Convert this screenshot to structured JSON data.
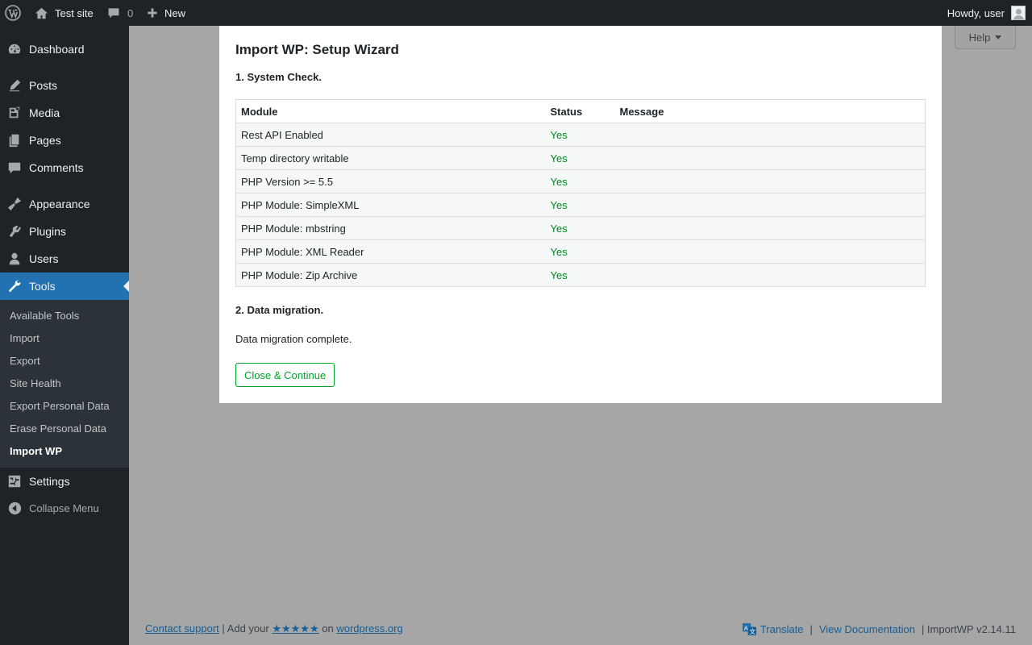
{
  "adminbar": {
    "site_name": "Test site",
    "comments_count": "0",
    "new_label": "New",
    "howdy": "Howdy, user"
  },
  "sidebar": {
    "items": [
      {
        "label": "Dashboard",
        "icon": "dashboard-icon"
      },
      {
        "label": "Posts",
        "icon": "posts-icon"
      },
      {
        "label": "Media",
        "icon": "media-icon"
      },
      {
        "label": "Pages",
        "icon": "pages-icon"
      },
      {
        "label": "Comments",
        "icon": "comments-icon"
      },
      {
        "label": "Appearance",
        "icon": "appearance-icon"
      },
      {
        "label": "Plugins",
        "icon": "plugins-icon"
      },
      {
        "label": "Users",
        "icon": "users-icon"
      },
      {
        "label": "Tools",
        "icon": "tools-icon"
      },
      {
        "label": "Settings",
        "icon": "settings-icon"
      }
    ],
    "submenu": [
      "Available Tools",
      "Import",
      "Export",
      "Site Health",
      "Export Personal Data",
      "Erase Personal Data",
      "Import WP"
    ],
    "collapse_label": "Collapse Menu"
  },
  "help": {
    "label": "Help"
  },
  "modal": {
    "title": "Import WP: Setup Wizard",
    "section1": "1. System Check.",
    "table": {
      "headers": [
        "Module",
        "Status",
        "Message"
      ],
      "rows": [
        [
          "Rest API Enabled",
          "Yes",
          ""
        ],
        [
          "Temp directory writable",
          "Yes",
          ""
        ],
        [
          "PHP Version >= 5.5",
          "Yes",
          ""
        ],
        [
          "PHP Module: SimpleXML",
          "Yes",
          ""
        ],
        [
          "PHP Module: mbstring",
          "Yes",
          ""
        ],
        [
          "PHP Module: XML Reader",
          "Yes",
          ""
        ],
        [
          "PHP Module: Zip Archive",
          "Yes",
          ""
        ]
      ]
    },
    "section2": "2. Data migration.",
    "migration_message": "Data migration complete.",
    "button": "Close & Continue"
  },
  "footer": {
    "contact": "Contact support",
    "add_your": "| Add your",
    "stars": "★★★★★",
    "on": "on",
    "wporg": "wordpress.org",
    "translate": "Translate",
    "separator": "|",
    "docs": "View Documentation",
    "version": "| ImportWP v2.14.11"
  },
  "colors": {
    "accent": "#2271b1",
    "success": "#00a32a",
    "admin_bg": "#1d2327"
  }
}
